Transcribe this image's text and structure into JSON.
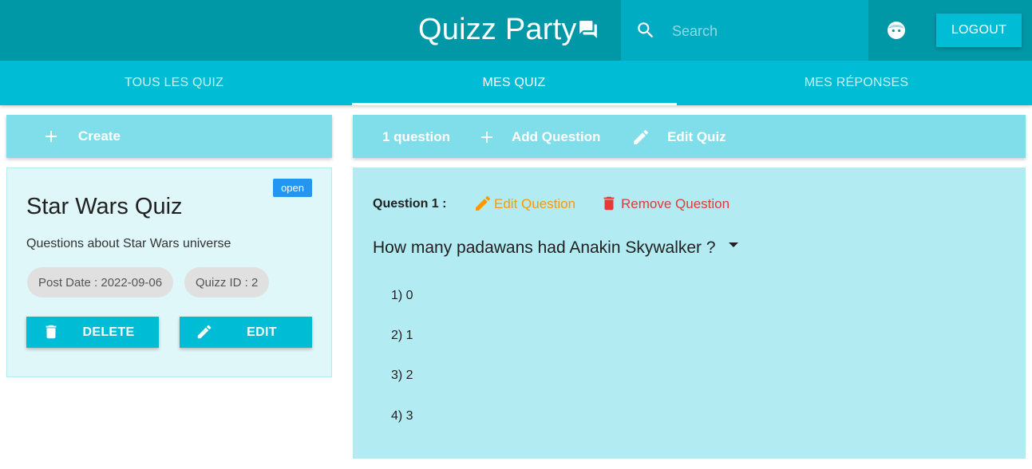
{
  "header": {
    "app_title": "Quizz Party",
    "search_placeholder": "Search",
    "logout_label": "LOGOUT",
    "icons": [
      "chat-icon",
      "search-icon",
      "face-icon"
    ]
  },
  "tabs": [
    {
      "label": "TOUS LES QUIZ",
      "active": false
    },
    {
      "label": "MES QUIZ",
      "active": true
    },
    {
      "label": "MES RÉPONSES",
      "active": false
    }
  ],
  "sidebar": {
    "create_label": "Create",
    "quiz_card": {
      "status": "open",
      "title": "Star Wars Quiz",
      "description": "Questions about Star Wars universe",
      "post_date": "Post Date : 2022-09-06",
      "quiz_id": "Quizz ID : 2",
      "delete_label": "DELETE",
      "edit_label": "EDIT"
    }
  },
  "main": {
    "toolbar": {
      "question_count": "1 question",
      "add_question_label": "Add Question",
      "edit_quiz_label": "Edit Quiz"
    },
    "question": {
      "label": "Question 1 :",
      "edit_label": "Edit Question",
      "remove_label": "Remove Question",
      "text": "How many padawans had Anakin Skywalker ?",
      "answers": [
        "1) 0",
        "2) 1",
        "3) 2",
        "4) 3"
      ]
    }
  },
  "colors": {
    "primary_dark": "#0097a7",
    "primary": "#00bcd4",
    "light_bar": "#80deea",
    "panel": "#b2ebf2",
    "card": "#e0f7fa",
    "badge": "#2196f3",
    "edit_accent": "#ff9800",
    "remove_accent": "#e53935"
  }
}
